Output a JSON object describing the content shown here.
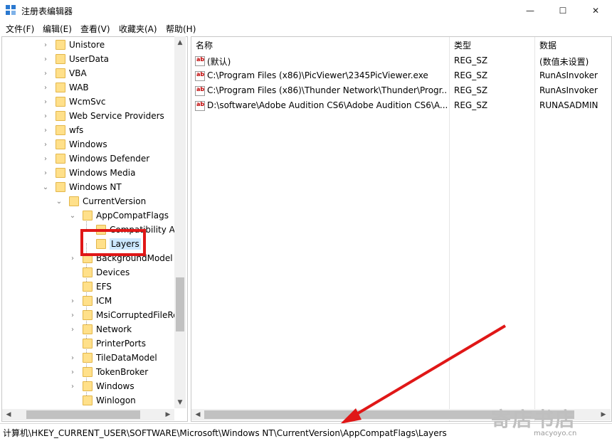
{
  "window": {
    "title": "注册表编辑器",
    "controls": {
      "minimize": "—",
      "maximize": "☐",
      "close": "✕"
    }
  },
  "menu": [
    "文件(F)",
    "编辑(E)",
    "查看(V)",
    "收藏夹(A)",
    "帮助(H)"
  ],
  "tree": [
    {
      "label": "Unistore",
      "expand": "›"
    },
    {
      "label": "UserData",
      "expand": "›"
    },
    {
      "label": "VBA",
      "expand": "›"
    },
    {
      "label": "WAB",
      "expand": "›"
    },
    {
      "label": "WcmSvc",
      "expand": "›"
    },
    {
      "label": "Web Service Providers",
      "expand": "›"
    },
    {
      "label": "wfs",
      "expand": "›"
    },
    {
      "label": "Windows",
      "expand": "›"
    },
    {
      "label": "Windows Defender",
      "expand": "›"
    },
    {
      "label": "Windows Media",
      "expand": "›"
    },
    {
      "label": "Windows NT",
      "expand": "⌄"
    },
    {
      "label": "CurrentVersion",
      "expand": "⌄"
    },
    {
      "label": "AppCompatFlags",
      "expand": "⌄"
    },
    {
      "label": "Compatibility As",
      "expand": ""
    },
    {
      "label": "Layers",
      "expand": "",
      "selected": true
    },
    {
      "label": "BackgroundModel",
      "expand": "›"
    },
    {
      "label": "Devices",
      "expand": ""
    },
    {
      "label": "EFS",
      "expand": ""
    },
    {
      "label": "ICM",
      "expand": "›"
    },
    {
      "label": "MsiCorruptedFileRe",
      "expand": "›"
    },
    {
      "label": "Network",
      "expand": "›"
    },
    {
      "label": "PrinterPorts",
      "expand": ""
    },
    {
      "label": "TileDataModel",
      "expand": "›"
    },
    {
      "label": "TokenBroker",
      "expand": "›"
    },
    {
      "label": "Windows",
      "expand": "›"
    },
    {
      "label": "Winlogon",
      "expand": ""
    }
  ],
  "columns": {
    "name": "名称",
    "type": "类型",
    "data": "数据"
  },
  "values": [
    {
      "name": "(默认)",
      "type": "REG_SZ",
      "data": "(数值未设置)"
    },
    {
      "name": "C:\\Program Files (x86)\\PicViewer\\2345PicViewer.exe",
      "type": "REG_SZ",
      "data": "RunAsInvoker"
    },
    {
      "name": "C:\\Program Files (x86)\\Thunder Network\\Thunder\\Progr...",
      "type": "REG_SZ",
      "data": "RunAsInvoker"
    },
    {
      "name": "D:\\software\\Adobe Audition CS6\\Adobe Audition CS6\\A...",
      "type": "REG_SZ",
      "data": "RUNASADMIN"
    }
  ],
  "value_icon_text": "ab",
  "status": "计算机\\HKEY_CURRENT_USER\\SOFTWARE\\Microsoft\\Windows NT\\CurrentVersion\\AppCompatFlags\\Layers",
  "watermark": {
    "main": "寄店书店",
    "sub": "macyoyo.cn"
  },
  "scroll_arrows": {
    "up": "▲",
    "down": "▼",
    "left": "◀",
    "right": "▶"
  },
  "colors": {
    "highlight": "#e01717",
    "arrow": "#e01717",
    "selection": "#cce8ff",
    "folder": "#ffe08a"
  }
}
